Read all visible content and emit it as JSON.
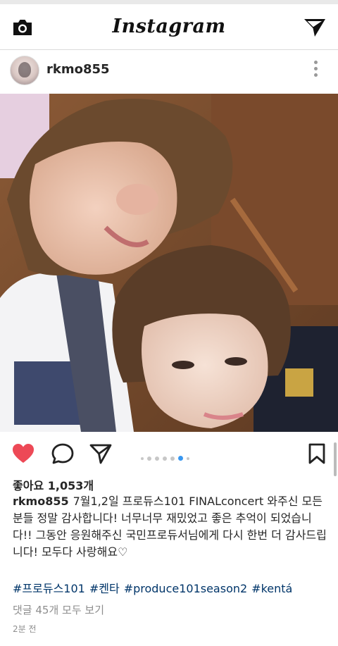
{
  "app": {
    "title": "Instagram"
  },
  "post": {
    "username": "rkmo855",
    "carousel": {
      "count": 7,
      "active_index": 5
    },
    "likes": "좋아요 1,053개",
    "caption_username": "rkmo855",
    "caption_text": "7월1,2일 프로듀스101 FINALconcert 와주신 모든분들 정말 감사합니다! 너무너무 재밌었고 좋은 추억이 되었습니다!! 그동안 응원해주신 국민프로듀서님에게 다시 한번 더 감사드립니다! 모두다 사랑해요♡",
    "hashtags": [
      "#프로듀스101",
      "#켄타",
      "#produce101season2",
      "#kentá"
    ],
    "comments_link": "댓글 45개 모두 보기",
    "timestamp": "2분 전",
    "liked": true
  },
  "colors": {
    "like": "#ed4956",
    "link": "#003569",
    "muted": "#8e8e8e",
    "dot_active": "#3897f0"
  },
  "icons": [
    "camera-icon",
    "direct-message-icon",
    "more-options-icon",
    "heart-icon",
    "comment-icon",
    "share-icon",
    "bookmark-icon"
  ]
}
